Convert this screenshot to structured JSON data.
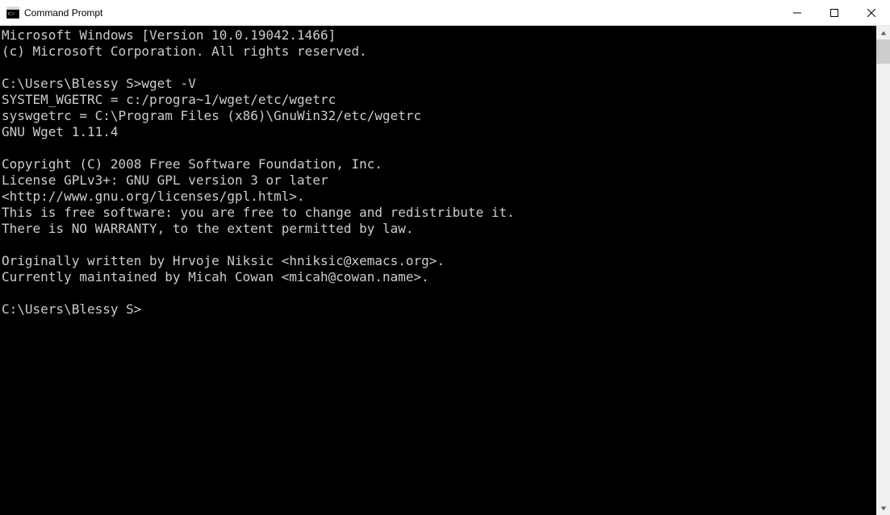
{
  "window": {
    "title": "Command Prompt"
  },
  "terminal": {
    "lines": [
      "Microsoft Windows [Version 10.0.19042.1466]",
      "(c) Microsoft Corporation. All rights reserved.",
      "",
      "C:\\Users\\Blessy S>wget -V",
      "SYSTEM_WGETRC = c:/progra~1/wget/etc/wgetrc",
      "syswgetrc = C:\\Program Files (x86)\\GnuWin32/etc/wgetrc",
      "GNU Wget 1.11.4",
      "",
      "Copyright (C) 2008 Free Software Foundation, Inc.",
      "License GPLv3+: GNU GPL version 3 or later",
      "<http://www.gnu.org/licenses/gpl.html>.",
      "This is free software: you are free to change and redistribute it.",
      "There is NO WARRANTY, to the extent permitted by law.",
      "",
      "Originally written by Hrvoje Niksic <hniksic@xemacs.org>.",
      "Currently maintained by Micah Cowan <micah@cowan.name>.",
      "",
      "C:\\Users\\Blessy S>"
    ]
  }
}
